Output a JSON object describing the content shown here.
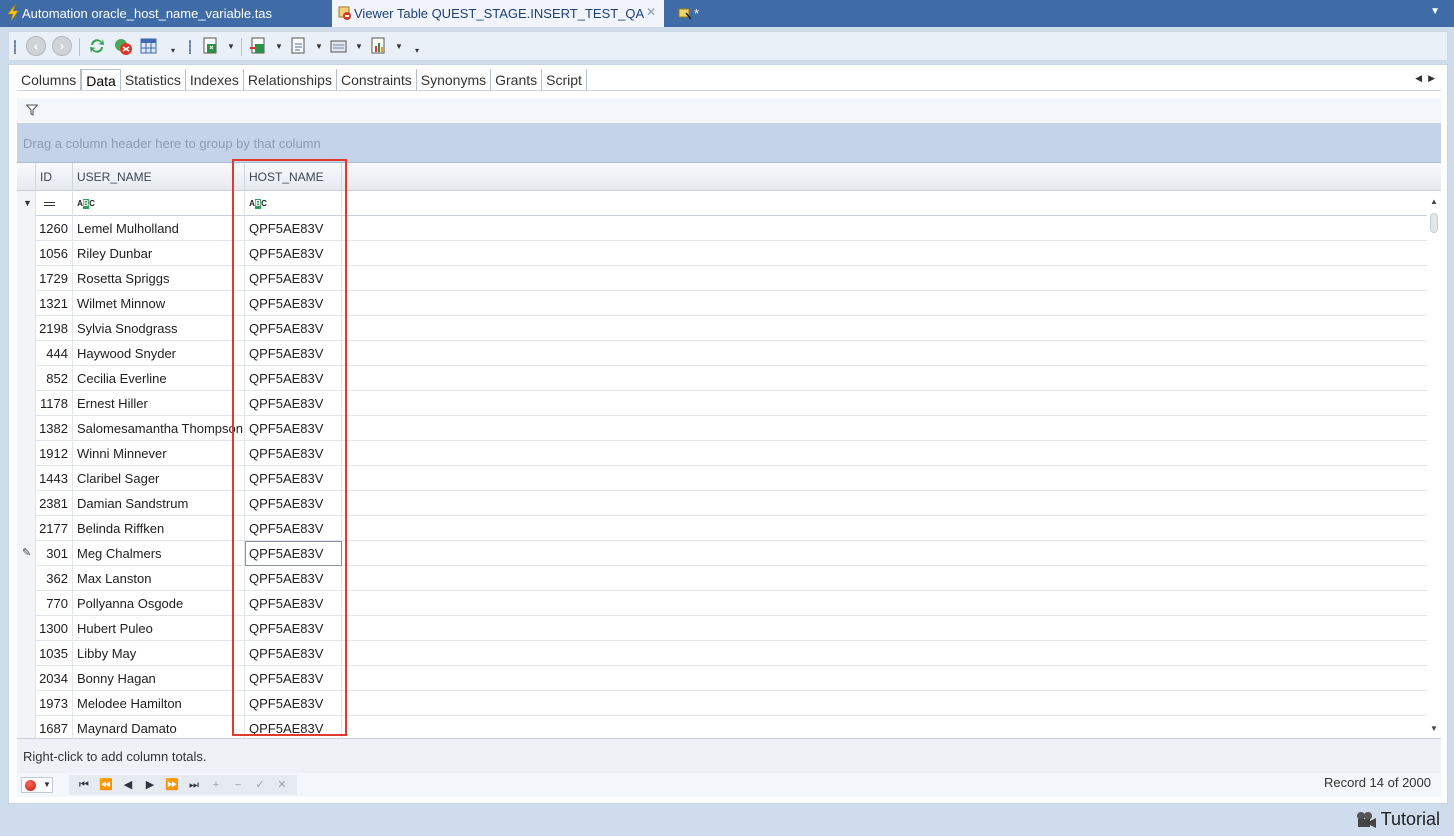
{
  "tabs": [
    {
      "title": "Automation oracle_host_name_variable.tas",
      "active": false
    },
    {
      "title": "Viewer Table QUEST_STAGE.INSERT_TEST_QA",
      "active": true
    },
    {
      "title": "*",
      "active": false
    }
  ],
  "subtabs": [
    "Columns",
    "Data",
    "Statistics",
    "Indexes",
    "Relationships",
    "Constraints",
    "Synonyms",
    "Grants",
    "Script"
  ],
  "active_subtab": "Data",
  "group_hint": "Drag a column header here to group by that column",
  "columns": [
    "ID",
    "USER_NAME",
    "HOST_NAME"
  ],
  "rows": [
    {
      "id": "1260",
      "user": "Lemel Mulholland",
      "host": "QPF5AE83V"
    },
    {
      "id": "1056",
      "user": "Riley Dunbar",
      "host": "QPF5AE83V"
    },
    {
      "id": "1729",
      "user": "Rosetta Spriggs",
      "host": "QPF5AE83V"
    },
    {
      "id": "1321",
      "user": "Wilmet Minnow",
      "host": "QPF5AE83V"
    },
    {
      "id": "2198",
      "user": "Sylvia Snodgrass",
      "host": "QPF5AE83V"
    },
    {
      "id": "444",
      "user": "Haywood Snyder",
      "host": "QPF5AE83V"
    },
    {
      "id": "852",
      "user": "Cecilia Everline",
      "host": "QPF5AE83V"
    },
    {
      "id": "1178",
      "user": "Ernest Hiller",
      "host": "QPF5AE83V"
    },
    {
      "id": "1382",
      "user": "Salomesamantha Thompson",
      "host": "QPF5AE83V"
    },
    {
      "id": "1912",
      "user": "Winni Minnever",
      "host": "QPF5AE83V"
    },
    {
      "id": "1443",
      "user": "Claribel Sager",
      "host": "QPF5AE83V"
    },
    {
      "id": "2381",
      "user": "Damian Sandstrum",
      "host": "QPF5AE83V"
    },
    {
      "id": "2177",
      "user": "Belinda Riffken",
      "host": "QPF5AE83V"
    },
    {
      "id": "301",
      "user": "Meg Chalmers",
      "host": "QPF5AE83V"
    },
    {
      "id": "362",
      "user": "Max Lanston",
      "host": "QPF5AE83V"
    },
    {
      "id": "770",
      "user": "Pollyanna Osgode",
      "host": "QPF5AE83V"
    },
    {
      "id": "1300",
      "user": "Hubert Puleo",
      "host": "QPF5AE83V"
    },
    {
      "id": "1035",
      "user": "Libby May",
      "host": "QPF5AE83V"
    },
    {
      "id": "2034",
      "user": "Bonny Hagan",
      "host": "QPF5AE83V"
    },
    {
      "id": "1973",
      "user": "Melodee Hamilton",
      "host": "QPF5AE83V"
    },
    {
      "id": "1687",
      "user": "Maynard Damato",
      "host": "QPF5AE83V"
    }
  ],
  "focused_row_index": 13,
  "footer_hint": "Right-click to add column totals.",
  "record_label": "Record 14 of 2000",
  "status_tutorial": "Tutorial",
  "colors": {
    "tab_strip": "#3f6ba6",
    "highlight_box": "#e2382d",
    "group_panel": "#c4d3e8"
  }
}
